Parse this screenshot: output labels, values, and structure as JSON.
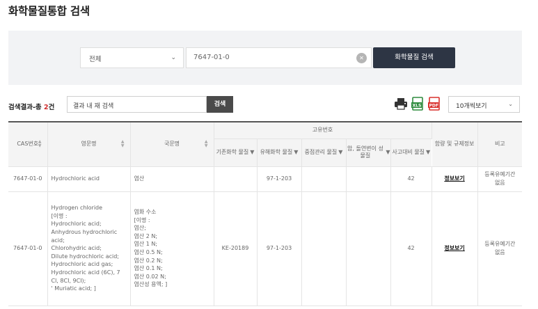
{
  "page": {
    "title": "화학물질통합 검색"
  },
  "search": {
    "category_selected": "전체",
    "query_value": "7647-01-0",
    "submit_label": "화학물질 검색"
  },
  "results_bar": {
    "count_prefix": "검색결과-총 ",
    "count_value": "2",
    "count_suffix": "건",
    "inner_search_placeholder": "결과 내 재 검색",
    "inner_search_button": "검색",
    "page_size_selected": "10개씩보기"
  },
  "table": {
    "headers": {
      "cas": "CAS번호",
      "en_name": "영문명",
      "kr_name": "국문명",
      "unique_no": "고유번호",
      "existing": "기존화학 물질",
      "toxic": "유해화학 물질",
      "priority": "중점관리 물질",
      "carcinogen": "암, 돌연변이 성 물질",
      "accident": "사고대비 물질",
      "content_reg": "함량 및 규제정보",
      "remark": "비고"
    },
    "rows": [
      {
        "cas": "7647-01-0",
        "en_name": "Hydrochloric acid",
        "kr_name": "염산",
        "existing": "",
        "toxic": "97-1-203",
        "priority": "",
        "carcinogen": "",
        "accident": "42",
        "info_link": "정보보기",
        "remark": "등록유예기간 없음"
      },
      {
        "cas": "7647-01-0",
        "en_name": "Hydrogen chloride\n[이명 :\nHydrochloric acid;\nAnhydrous hydrochloric acid;\nChlorohydric acid;\nDilute hydrochloric acid;\nHydrochloric acid gas;\nHydrochloric acid (6C), 7 Cl, 8CI, 9CI);\n' Muriatic acid; ]",
        "kr_name": "염화 수소\n[이명 :\n염산;\n염산 2 N;\n염산 1 N;\n염산 0.5 N;\n염산 0.2 N;\n염산 0.1 N;\n염산 0.02 N;\n염산성 용액; ]",
        "existing": "KE-20189",
        "toxic": "97-1-203",
        "priority": "",
        "carcinogen": "",
        "accident": "42",
        "info_link": "정보보기",
        "remark": "등록유예기간 없음"
      }
    ]
  },
  "colors": {
    "accent_dark": "#2d3544",
    "count_red": "#d02d2d",
    "excel_green": "#2e8b3e",
    "pdf_red": "#d9302c"
  }
}
